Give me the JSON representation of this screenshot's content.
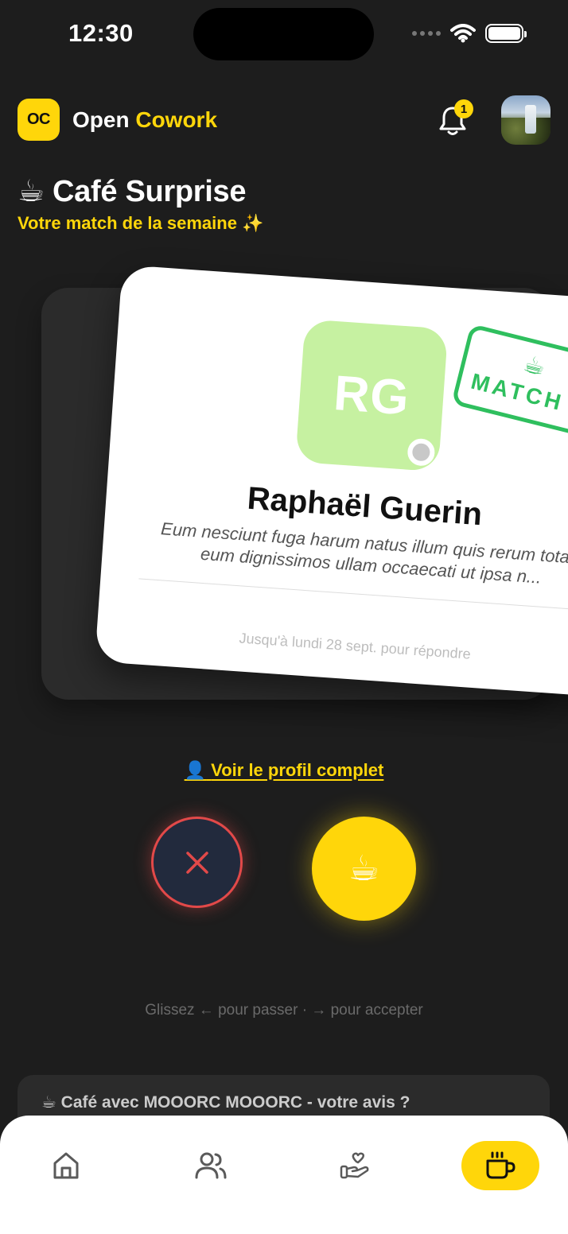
{
  "status_bar": {
    "time": "12:30"
  },
  "header": {
    "logo_text": "OC",
    "app_name_primary": "Open",
    "app_name_accent": "Cowork",
    "notification_count": "1"
  },
  "section": {
    "title": "☕ Café Surprise",
    "subtitle": "Votre match de la semaine ✨"
  },
  "match_card": {
    "initials": "RG",
    "stamp_icon": "☕",
    "stamp_label": "MATCH !",
    "name": "Raphaël Guerin",
    "bio": "Eum nesciunt fuga harum natus illum quis rerum totam eum dignissimos ullam occaecati ut ipsa n...",
    "deadline": "Jusqu'à lundi 28 sept. pour répondre",
    "avatar_color": "#c6f1a1",
    "stamp_color": "#2fbf5e"
  },
  "actions": {
    "profile_icon": "👤",
    "profile_link": "Voir le profil complet",
    "accept_icon": "☕",
    "swipe_hint": "Glissez ← pour passer · → pour accepter"
  },
  "feedback": {
    "text": "☕ Café avec MOOORC MOOORC - votre avis ?"
  },
  "nav": {
    "items": [
      {
        "icon": "home-icon",
        "active": false
      },
      {
        "icon": "users-icon",
        "active": false
      },
      {
        "icon": "hand-heart-icon",
        "active": false
      },
      {
        "icon": "coffee-cup-icon",
        "active": true
      }
    ]
  },
  "colors": {
    "accent": "#ffd60a",
    "background": "#1d1d1d",
    "pass_red": "#e24949"
  }
}
